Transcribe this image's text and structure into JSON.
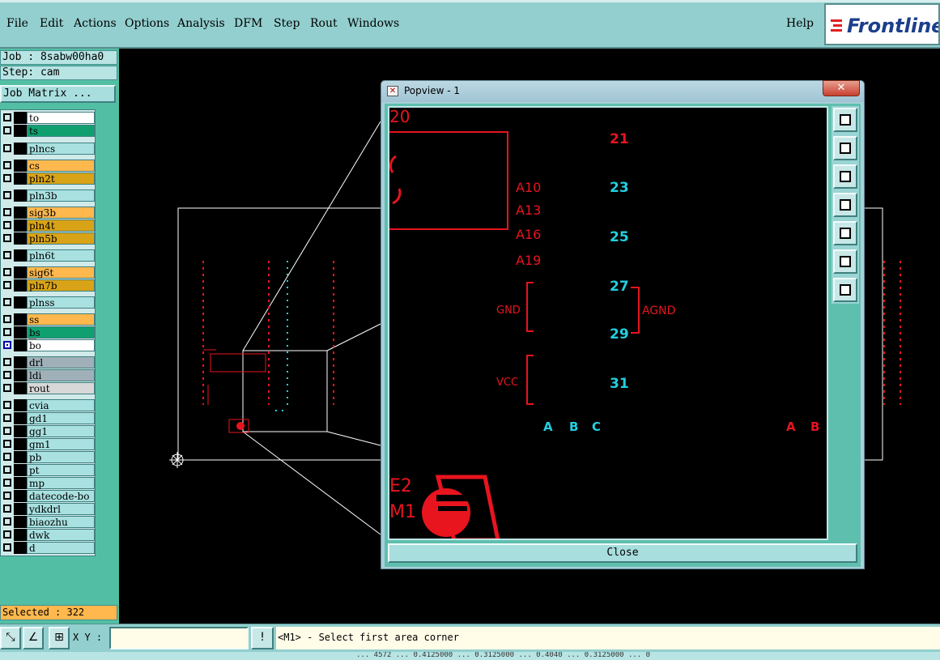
{
  "menu": {
    "items": [
      {
        "label": "File"
      },
      {
        "label": "Edit"
      },
      {
        "label": "Actions"
      },
      {
        "label": "Options"
      },
      {
        "label": "Analysis"
      },
      {
        "label": "DFM"
      },
      {
        "label": "Step"
      },
      {
        "label": "Rout"
      },
      {
        "label": "Windows"
      }
    ],
    "help": "Help",
    "brand": "Frontline"
  },
  "job": {
    "job_line": "Job : 8sabw00ha0",
    "step_line": "Step: cam",
    "job_matrix": "Job Matrix ...",
    "selected": "Selected : 322"
  },
  "layers": [
    {
      "name": "to",
      "type": "white",
      "checked": false
    },
    {
      "name": "ts",
      "type": "mask",
      "checked": false
    },
    {
      "name": "plncs",
      "type": "board",
      "checked": false
    },
    {
      "name": "cs",
      "type": "signal",
      "checked": false
    },
    {
      "name": "pln2t",
      "type": "power",
      "checked": false
    },
    {
      "name": "pln3b",
      "type": "board",
      "checked": false
    },
    {
      "name": "sig3b",
      "type": "signal",
      "checked": false
    },
    {
      "name": "pln4t",
      "type": "power",
      "checked": false
    },
    {
      "name": "pln5b",
      "type": "power",
      "checked": false
    },
    {
      "name": "pln6t",
      "type": "board",
      "checked": false
    },
    {
      "name": "sig6t",
      "type": "signal",
      "checked": false
    },
    {
      "name": "pln7b",
      "type": "power",
      "checked": false
    },
    {
      "name": "plnss",
      "type": "board",
      "checked": false
    },
    {
      "name": "ss",
      "type": "signal",
      "checked": false
    },
    {
      "name": "bs",
      "type": "mask",
      "checked": false
    },
    {
      "name": "bo",
      "type": "white",
      "checked": true
    },
    {
      "name": "drl",
      "type": "drill",
      "checked": false
    },
    {
      "name": "ldi",
      "type": "drill",
      "checked": false
    },
    {
      "name": "rout",
      "type": "grey",
      "checked": false
    },
    {
      "name": "cvia",
      "type": "board",
      "checked": false
    },
    {
      "name": "gd1",
      "type": "board",
      "checked": false
    },
    {
      "name": "gg1",
      "type": "board",
      "checked": false
    },
    {
      "name": "gm1",
      "type": "board",
      "checked": false
    },
    {
      "name": "pb",
      "type": "board",
      "checked": false
    },
    {
      "name": "pt",
      "type": "board",
      "checked": false
    },
    {
      "name": "mp",
      "type": "board",
      "checked": false
    },
    {
      "name": "datecode-bo",
      "type": "board",
      "checked": false
    },
    {
      "name": "ydkdrl",
      "type": "board",
      "checked": false
    },
    {
      "name": "biaozhu",
      "type": "board",
      "checked": false
    },
    {
      "name": "dwk",
      "type": "board",
      "checked": false
    },
    {
      "name": "d",
      "type": "board",
      "checked": false
    }
  ],
  "popview": {
    "title": "Popview - 1",
    "close_label": "Close",
    "red_labels": [
      "20",
      "A10",
      "A13",
      "A16",
      "A19",
      "GND",
      "AGND",
      "VCC",
      "E2",
      "M1"
    ],
    "cyan_labels": [
      "21",
      "23",
      "25",
      "27",
      "29",
      "31",
      "C",
      "B",
      "A",
      "B",
      "A"
    ]
  },
  "bottom": {
    "xy_label": "X Y :",
    "xy_value": "",
    "warn": "!",
    "prompt": "<M1> - Select first area corner",
    "status": "... 4572 ... 0.4125000 ... 0.3125000 ... 0.4040 ... 0.3125000 ... 0"
  },
  "colors": {
    "ui_teal": "#93cfcf",
    "panel_green": "#52bfa4",
    "pcb_red": "#e8141e",
    "pcb_cyan": "#22d0e0"
  }
}
